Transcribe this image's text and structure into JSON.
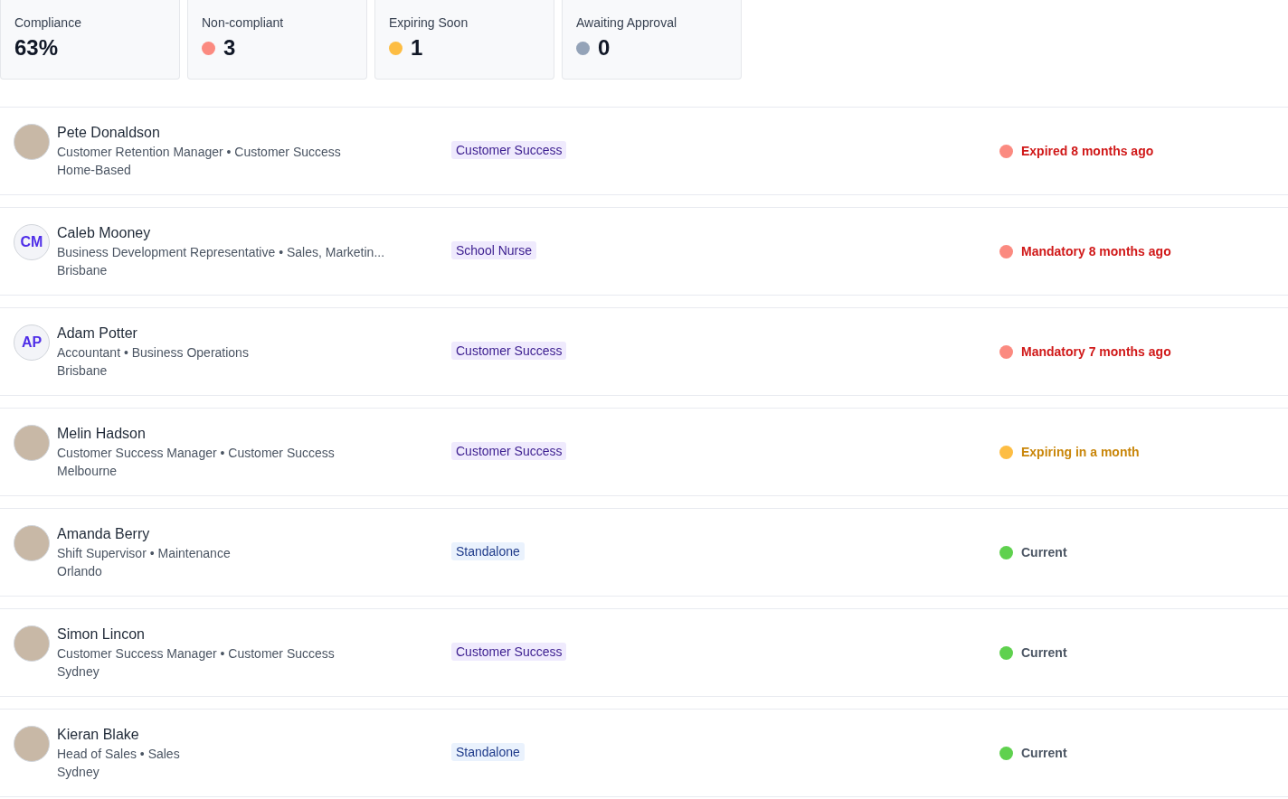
{
  "summary_cards": [
    {
      "label": "Compliance",
      "value": "63%"
    },
    {
      "label": "Non-compliant",
      "value": "3",
      "color": "#fb8a80"
    },
    {
      "label": "Expiring Soon",
      "value": "1",
      "color": "#fdbd43"
    },
    {
      "label": "Awaiting Approval",
      "value": "0",
      "color": "#94a3b8"
    }
  ],
  "people": [
    {
      "name": "Pete Donaldson",
      "subtitle": "Customer Retention Manager • Customer Success",
      "location": "Home-Based",
      "avatar": {
        "kind": "photo"
      },
      "tag": {
        "label": "Customer Success",
        "kind": "program"
      },
      "status": {
        "text": "Expired 8 months ago",
        "kind": "overdue",
        "color": "#fb8a80"
      }
    },
    {
      "name": "Caleb Mooney",
      "subtitle": "Business Development Representative • Sales, Marketin...",
      "location": "Brisbane",
      "avatar": {
        "kind": "initials",
        "text": "CM"
      },
      "tag": {
        "label": "School Nurse",
        "kind": "program"
      },
      "status": {
        "text": "Mandatory 8 months ago",
        "kind": "overdue",
        "color": "#fb8a80"
      }
    },
    {
      "name": "Adam Potter",
      "subtitle": "Accountant • Business Operations",
      "location": "Brisbane",
      "avatar": {
        "kind": "initials",
        "text": "AP"
      },
      "tag": {
        "label": "Customer Success",
        "kind": "program"
      },
      "status": {
        "text": "Mandatory 7 months ago",
        "kind": "overdue",
        "color": "#fb8a80"
      }
    },
    {
      "name": "Melin Hadson",
      "subtitle": "Customer Success Manager • Customer Success",
      "location": "Melbourne",
      "avatar": {
        "kind": "photo"
      },
      "tag": {
        "label": "Customer Success",
        "kind": "program"
      },
      "status": {
        "text": "Expiring in a month",
        "kind": "expiring",
        "color": "#fdbd43"
      }
    },
    {
      "name": "Amanda Berry",
      "subtitle": "Shift Supervisor • Maintenance",
      "location": "Orlando",
      "avatar": {
        "kind": "photo"
      },
      "tag": {
        "label": "Standalone",
        "kind": "standalone"
      },
      "status": {
        "text": "Current",
        "kind": "current",
        "color": "#5fd14e"
      }
    },
    {
      "name": "Simon Lincon",
      "subtitle": "Customer Success Manager • Customer Success",
      "location": "Sydney",
      "avatar": {
        "kind": "photo"
      },
      "tag": {
        "label": "Customer Success",
        "kind": "program"
      },
      "status": {
        "text": "Current",
        "kind": "current",
        "color": "#5fd14e"
      }
    },
    {
      "name": "Kieran Blake",
      "subtitle": "Head of Sales • Sales",
      "location": "Sydney",
      "avatar": {
        "kind": "photo"
      },
      "tag": {
        "label": "Standalone",
        "kind": "standalone"
      },
      "status": {
        "text": "Current",
        "kind": "current",
        "color": "#5fd14e"
      }
    }
  ]
}
